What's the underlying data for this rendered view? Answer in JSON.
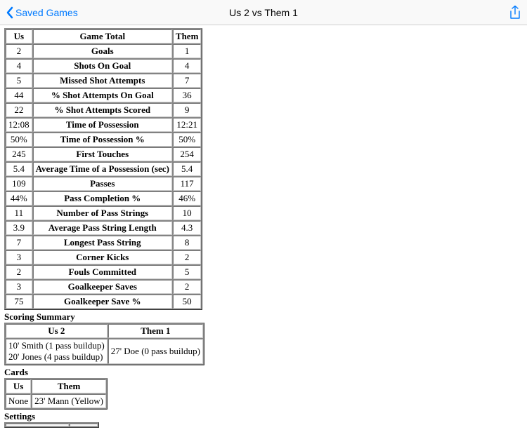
{
  "nav": {
    "back_label": "Saved Games",
    "title": "Us 2 vs Them 1"
  },
  "stats": {
    "headers": {
      "us": "Us",
      "mid": "Game Total",
      "them": "Them"
    },
    "rows": [
      {
        "us": "2",
        "label": "Goals",
        "them": "1"
      },
      {
        "us": "4",
        "label": "Shots On Goal",
        "them": "4"
      },
      {
        "us": "5",
        "label": "Missed Shot Attempts",
        "them": "7"
      },
      {
        "us": "44",
        "label": "% Shot Attempts On Goal",
        "them": "36"
      },
      {
        "us": "22",
        "label": "% Shot Attempts Scored",
        "them": "9"
      },
      {
        "us": "12:08",
        "label": "Time of Possession",
        "them": "12:21"
      },
      {
        "us": "50%",
        "label": "Time of Possession %",
        "them": "50%"
      },
      {
        "us": "245",
        "label": "First Touches",
        "them": "254"
      },
      {
        "us": "5.4",
        "label": "Average Time of a Possession (sec)",
        "them": "5.4"
      },
      {
        "us": "109",
        "label": "Passes",
        "them": "117"
      },
      {
        "us": "44%",
        "label": "Pass Completion %",
        "them": "46%"
      },
      {
        "us": "11",
        "label": "Number of Pass Strings",
        "them": "10"
      },
      {
        "us": "3.9",
        "label": "Average Pass String Length",
        "them": "4.3"
      },
      {
        "us": "7",
        "label": "Longest Pass String",
        "them": "8"
      },
      {
        "us": "3",
        "label": "Corner Kicks",
        "them": "2"
      },
      {
        "us": "2",
        "label": "Fouls Committed",
        "them": "5"
      },
      {
        "us": "3",
        "label": "Goalkeeper Saves",
        "them": "2"
      },
      {
        "us": "75",
        "label": "Goalkeeper Save %",
        "them": "50"
      }
    ]
  },
  "scoring": {
    "title": "Scoring Summary",
    "headers": {
      "us": "Us 2",
      "them": "Them 1"
    },
    "us_lines": [
      "10' Smith (1 pass buildup)",
      "20' Jones (4 pass buildup)"
    ],
    "them_lines": [
      "27' Doe (0 pass buildup)"
    ]
  },
  "cards": {
    "title": "Cards",
    "headers": {
      "us": "Us",
      "them": "Them"
    },
    "us": "None",
    "them": "23' Mann (Yellow)"
  },
  "settings": {
    "title": "Settings"
  }
}
